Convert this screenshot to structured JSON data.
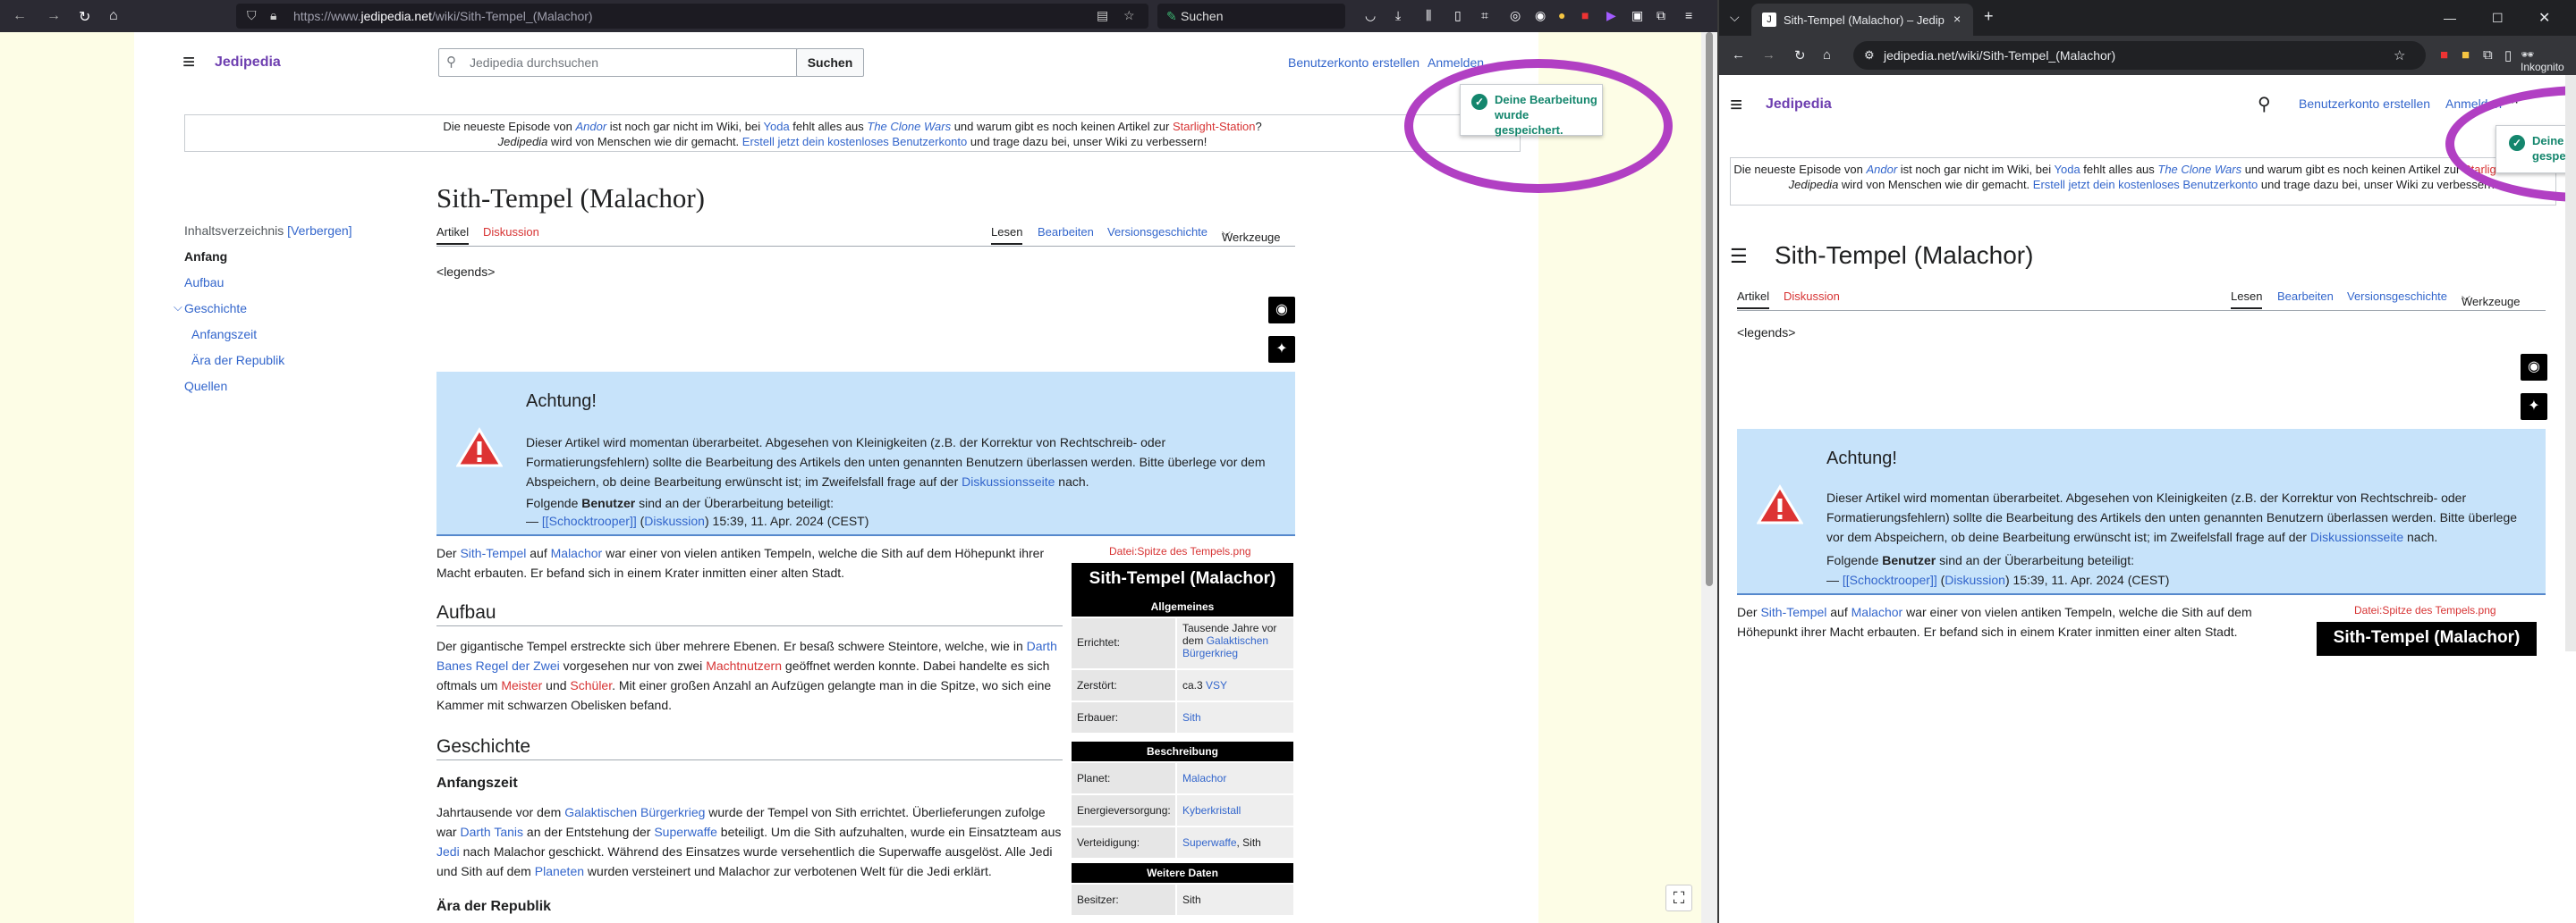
{
  "firefox": {
    "url_prefix": "https://www.",
    "url_domain": "jedipedia.net",
    "url_path": "/wiki/Sith-Tempel_(Malachor)",
    "search_placeholder": "Suchen"
  },
  "chrome": {
    "tab_title": "Sith-Tempel (Malachor) – Jedip",
    "url": "jedipedia.net/wiki/Sith-Tempel_(Malachor)",
    "incognito_label": "Inkognito"
  },
  "wiki": {
    "logo": "Jedipedia",
    "search_placeholder": "Jedipedia durchsuchen",
    "search_button": "Suchen",
    "create_account": "Benutzerkonto erstellen",
    "login": "Anmelden",
    "notice": {
      "t1": "Die neueste Episode von ",
      "andor": "Andor",
      "t2": " ist noch gar nicht im Wiki, bei ",
      "yoda": "Yoda",
      "t3": " fehlt alles aus ",
      "clonewars": "The Clone Wars",
      "t4": " und warum gibt es noch keinen Artikel zur ",
      "starlight": "Starlight-Station",
      "t5": "?",
      "l2a": "Jedipedia",
      "l2b": " wird von Menschen wie dir gemacht. ",
      "l2link": "Erstell jetzt dein kostenloses Benutzerkonto",
      "l2c": " und trage dazu bei, unser Wiki zu verbessern!"
    },
    "toc": {
      "heading": "Inhaltsverzeichnis",
      "hide": "[Verbergen]",
      "items": [
        "Anfang",
        "Aufbau",
        "Geschichte",
        "Anfangszeit",
        "Ära der Republik",
        "Quellen"
      ]
    },
    "title": "Sith-Tempel (Malachor)",
    "tabs": {
      "article": "Artikel",
      "discussion": "Diskussion",
      "read": "Lesen",
      "edit": "Bearbeiten",
      "history": "Versionsgeschichte",
      "tools": "Werkzeuge"
    },
    "legends": "<legends>",
    "achtung": {
      "heading": "Achtung!",
      "text_a": "Dieser Artikel wird momentan überarbeitet. Abgesehen von Kleinigkeiten (z.B. der Korrektur von Rechtschreib- oder Formatierungsfehlern) sollte die Bearbeitung des Artikels den unten genannten Benutzern überlassen werden. Bitte überlege vor dem Abspeichern, ob deine Bearbeitung erwünscht ist; im Zweifelsfall frage auf der ",
      "text_link": "Diskussionsseite",
      "text_b": " nach.",
      "following_a": "Folgende ",
      "following_b": "Benutzer",
      "following_c": " sind an der Überarbeitung beteiligt:",
      "sig_dash": "— ",
      "sig_user": "[[Schocktrooper]]",
      "sig_open": " (",
      "sig_disc": "Diskussion",
      "sig_close": ") 15:39, 11. Apr. 2024 (CEST)"
    },
    "intro": {
      "a": "Der ",
      "l1": "Sith-Tempel",
      "b": " auf ",
      "l2": "Malachor",
      "c": " war einer von vielen antiken Tempeln, welche die Sith auf dem Höhepunkt ihrer Macht erbauten. Er befand sich in einem Krater inmitten einer alten Stadt."
    },
    "aufbau": {
      "heading": "Aufbau",
      "a": "Der gigantische Tempel erstreckte sich über mehrere Ebenen. Er besaß schwere Steintore, welche, wie in ",
      "l1": "Darth Banes",
      "b": " ",
      "l2": "Regel der Zwei",
      "c": " vorgesehen nur von zwei ",
      "l3": "Machtnutzern",
      "d": " geöffnet werden konnte. Dabei handelte es sich oftmals um ",
      "l4": "Meister",
      "e": " und ",
      "l5": "Schüler",
      "f": ". Mit einer großen Anzahl an Aufzügen gelangte man in die Spitze, wo sich eine Kammer mit schwarzen Obelisken befand."
    },
    "geschichte": {
      "heading": "Geschichte",
      "sub1": "Anfangszeit",
      "a": "Jahrtausende vor dem ",
      "l1": "Galaktischen Bürgerkrieg",
      "b": " wurde der Tempel von Sith errichtet. Überlieferungen zufolge war ",
      "l2": "Darth Tanis",
      "c": " an der Entstehung der ",
      "l3": "Superwaffe",
      "d": " beteiligt. Um die Sith aufzuhalten, wurde ein Einsatzteam aus ",
      "l4": "Jedi",
      "e": " nach Malachor geschickt. Während des Einsatzes wurde versehentlich die Superwaffe ausgelöst. Alle Jedi und Sith auf dem ",
      "l5": "Planeten",
      "f": " wurden versteinert und Malachor zur verbotenen Welt für die Jedi erklärt.",
      "sub2": "Ära der Republik"
    },
    "infobox": {
      "caption": "Datei:Spitze des Tempels.png",
      "title": "Sith-Tempel (Malachor)",
      "sec1": "Allgemeines",
      "k1": "Errichtet:",
      "v1a": "Tausende Jahre vor dem ",
      "v1link": "Galaktischen Bürgerkrieg",
      "k2": "Zerstört:",
      "v2a": "ca.3 ",
      "v2link": "VSY",
      "k3": "Erbauer:",
      "v3link": "Sith",
      "sec2": "Beschreibung",
      "k4": "Planet:",
      "v4link": "Malachor",
      "k5": "Energieversorgung:",
      "v5link": "Kyberkristall",
      "k6": "Verteidigung:",
      "v6link": "Superwaffe",
      "v6b": ", Sith",
      "sec3": "Weitere Daten",
      "k7": "Besitzer:",
      "v7": "Sith"
    },
    "toast": "Deine Bearbeitung wurde gespeichert."
  }
}
